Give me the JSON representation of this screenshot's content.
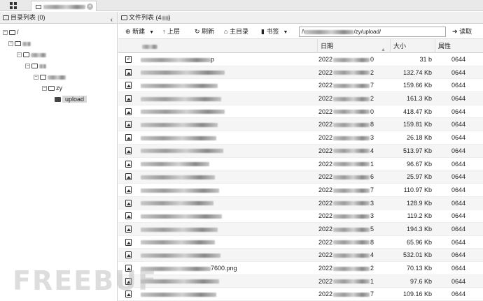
{
  "tab": {
    "label": ""
  },
  "left_panel": {
    "title": "目录列表 (0)",
    "collapse_glyph": "‹",
    "tree": [
      {
        "label": "/",
        "level": 0
      },
      {
        "label": "",
        "level": 1
      },
      {
        "label": "",
        "level": 2
      },
      {
        "label": "",
        "level": 3
      },
      {
        "label": "",
        "level": 4
      },
      {
        "label": "zy",
        "level": 5
      },
      {
        "label": "upload",
        "level": 6,
        "selected": true
      }
    ]
  },
  "right_panel": {
    "title": "文件列表 (4",
    "title_suffix": ")",
    "toolbar": {
      "new_label": "新建",
      "up_label": "上层",
      "refresh_label": "刷新",
      "home_label": "主目录",
      "bookmark_label": "书签",
      "path_value": "/\\",
      "path_suffix": "/zy/upload/",
      "read_label": "读取"
    },
    "columns": {
      "name": "",
      "date": "日期",
      "size": "大小",
      "perm": "属性"
    },
    "files": [
      {
        "icon": "svg-icon",
        "name_end": "p",
        "date_start": "2022",
        "date_end": "0",
        "size": "31 b",
        "perm": "0644"
      },
      {
        "icon": "image-icon",
        "name_end": "",
        "date_start": "2022",
        "date_end": "2",
        "size": "132.74 Kb",
        "perm": "0644"
      },
      {
        "icon": "image-icon",
        "name_end": "",
        "date_start": "2022",
        "date_end": "7",
        "size": "159.66 Kb",
        "perm": "0644"
      },
      {
        "icon": "image-icon",
        "name_end": "",
        "date_start": "2022",
        "date_end": "2",
        "size": "161.3 Kb",
        "perm": "0644"
      },
      {
        "icon": "image-icon",
        "name_end": "",
        "date_start": "2022",
        "date_end": "0",
        "size": "418.47 Kb",
        "perm": "0644"
      },
      {
        "icon": "image-icon",
        "name_end": "",
        "date_start": "2022",
        "date_end": "8",
        "size": "159.81 Kb",
        "perm": "0644"
      },
      {
        "icon": "image-icon",
        "name_end": "",
        "date_start": "2022",
        "date_end": "3",
        "size": "26.18 Kb",
        "perm": "0644"
      },
      {
        "icon": "image-icon",
        "name_end": "",
        "date_start": "2022",
        "date_end": "4",
        "size": "513.97 Kb",
        "perm": "0644"
      },
      {
        "icon": "image-icon",
        "name_end": "",
        "date_start": "2022",
        "date_end": "1",
        "size": "96.67 Kb",
        "perm": "0644"
      },
      {
        "icon": "image-icon",
        "name_end": "",
        "date_start": "2022",
        "date_end": "6",
        "size": "25.97 Kb",
        "perm": "0644"
      },
      {
        "icon": "image-icon",
        "name_end": "",
        "date_start": "2022",
        "date_end": "7",
        "size": "110.97 Kb",
        "perm": "0644"
      },
      {
        "icon": "image-icon",
        "name_end": "",
        "date_start": "2022",
        "date_end": "3",
        "size": "128.9 Kb",
        "perm": "0644"
      },
      {
        "icon": "image-icon",
        "name_end": "",
        "date_start": "2022",
        "date_end": "3",
        "size": "119.2 Kb",
        "perm": "0644"
      },
      {
        "icon": "image-icon",
        "name_end": "",
        "date_start": "2022",
        "date_end": "5",
        "size": "194.3 Kb",
        "perm": "0644"
      },
      {
        "icon": "image-icon",
        "name_end": "",
        "date_start": "2022",
        "date_end": "8",
        "size": "65.96 Kb",
        "perm": "0644"
      },
      {
        "icon": "image-icon",
        "name_end": "",
        "date_start": "2022",
        "date_end": "4",
        "size": "532.01 Kb",
        "perm": "0644"
      },
      {
        "icon": "image-icon",
        "name_end": "7600.png",
        "date_start": "2022",
        "date_end": "2",
        "size": "70.13 Kb",
        "perm": "0644"
      },
      {
        "icon": "image-icon",
        "name_end": "",
        "date_start": "2022",
        "date_end": "1",
        "size": "97.6 Kb",
        "perm": "0644"
      },
      {
        "icon": "image-icon",
        "name_end": "",
        "date_start": "2022",
        "date_end": "7",
        "size": "109.16 Kb",
        "perm": "0644"
      }
    ]
  },
  "watermark": "FREEBUF"
}
